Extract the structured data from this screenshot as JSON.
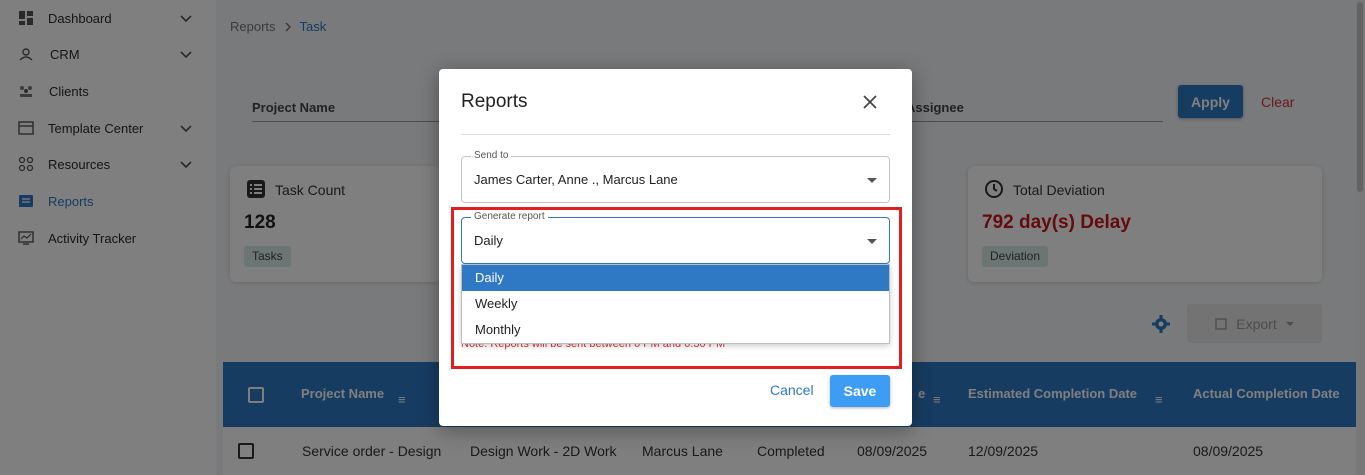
{
  "sidebar": {
    "items": [
      {
        "label": "Dashboard",
        "icon": "dashboard-icon"
      },
      {
        "label": "CRM",
        "icon": "crm-icon"
      },
      {
        "label": "Clients",
        "icon": "clients-icon"
      },
      {
        "label": "Template Center",
        "icon": "template-icon"
      },
      {
        "label": "Resources",
        "icon": "resources-icon"
      },
      {
        "label": "Reports",
        "icon": "reports-icon",
        "active": true
      },
      {
        "label": "Activity Tracker",
        "icon": "activity-icon"
      }
    ]
  },
  "breadcrumb": {
    "root": "Reports",
    "current": "Task"
  },
  "filters": {
    "project_name": "Project Name",
    "assignee": "Assignee",
    "apply": "Apply",
    "clear": "Clear"
  },
  "cards": {
    "task_count": {
      "title": "Task Count",
      "value": "128",
      "tag": "Tasks"
    },
    "total_deviation": {
      "title": "Total Deviation",
      "value": "792 day(s) Delay",
      "tag": "Deviation"
    }
  },
  "toolbar": {
    "export": "Export"
  },
  "table": {
    "headers": [
      "Project Name",
      "Estimated Completion Date",
      "Actual Completion Date"
    ],
    "header_partial": "e",
    "row": [
      "Service order - Design",
      "Design Work - 2D Work",
      "Marcus Lane",
      "Completed",
      "08/09/2025",
      "12/09/2025",
      "08/09/2025"
    ]
  },
  "modal": {
    "title": "Reports",
    "send_to_label": "Send to",
    "send_to_value": "James Carter, Anne ., Marcus Lane",
    "generate_label": "Generate report",
    "generate_value": "Daily",
    "options": [
      "Daily",
      "Weekly",
      "Monthly"
    ],
    "selected_option": "Daily",
    "note": "Note: Reports will be sent between 6 PM and 6:30 PM",
    "cancel": "Cancel",
    "save": "Save"
  },
  "colors": {
    "accent": "#2f78c4",
    "danger": "#d9363e",
    "deviation": "#c8161d",
    "highlight": "#e0201f"
  }
}
